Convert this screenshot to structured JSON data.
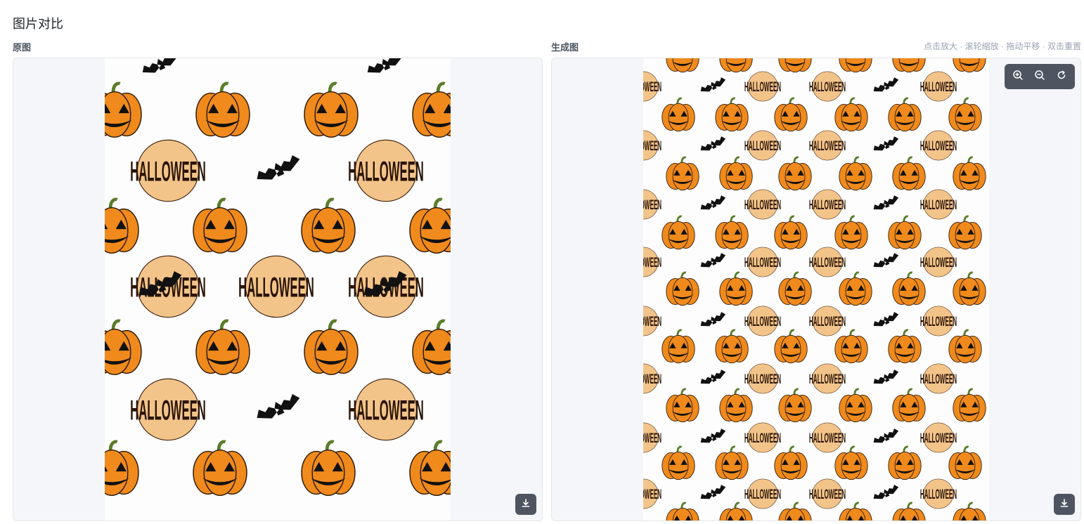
{
  "page": {
    "title": "图片对比"
  },
  "left": {
    "label": "原图",
    "pattern": {
      "pumpkin_rows": 4,
      "word_rows": 3,
      "scale": "large",
      "art_text": "HALLOWEEN"
    }
  },
  "right": {
    "label": "生成图",
    "hint": "点击放大 · 滚轮缩放 · 拖动平移 · 双击重置",
    "pattern": {
      "pumpkin_rows": 8,
      "word_rows": 8,
      "scale": "small",
      "art_text": "HALLOWEEN"
    }
  },
  "icons": {
    "zoom_in": "zoom-in-icon",
    "zoom_out": "zoom-out-icon",
    "reset": "reset-icon",
    "download": "download-icon"
  },
  "colors": {
    "pumpkin": "#f08a1c",
    "pumpkin_outline": "#2b1a0a",
    "stem": "#5a7d2a",
    "bat": "#111111",
    "toolbar_bg": "#4e5561",
    "hint_text": "#9aa3b2"
  }
}
